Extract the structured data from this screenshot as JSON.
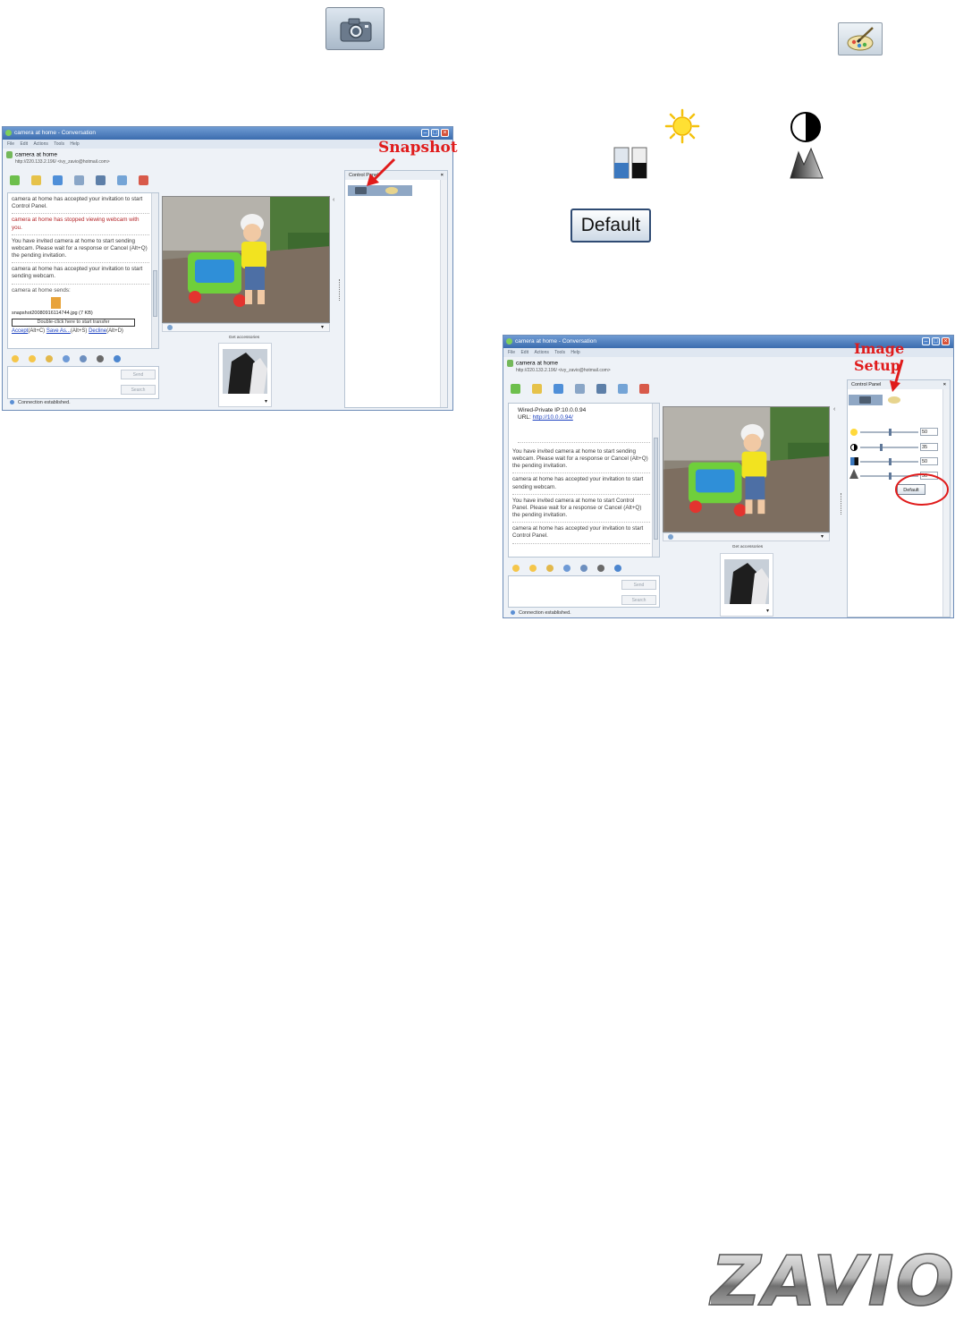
{
  "colors": {
    "accent_red": "#e01b1b",
    "title_blue": "#3b6cae",
    "logo_gray": "#8a8a8a"
  },
  "icons": {
    "snapshot_button": "camera-icon",
    "image_setup_button": "palette-brush-icon",
    "brightness": "sun-icon",
    "contrast": "half-circle-icon",
    "saturation": "color-bars-icon",
    "sharpness": "mountain-icon"
  },
  "default_button": {
    "label": "Default"
  },
  "window1": {
    "title": "camera at home - Conversation",
    "menu": [
      "File",
      "Edit",
      "Actions",
      "Tools",
      "Help"
    ],
    "contact_name": "camera at home",
    "contact_address": "http://220.133.2.196/ <ivy_zavio@hotmail.com>",
    "messages": [
      {
        "text": "camera at home has accepted your invitation to start Control Panel.",
        "style": "normal"
      },
      {
        "text": "camera at home has stopped viewing webcam with you.",
        "style": "red"
      },
      {
        "text": "You have invited camera at home to start sending webcam. Please wait for a response or Cancel (Alt+Q) the pending invitation.",
        "style": "normal"
      },
      {
        "text": "camera at home has accepted your invitation to start sending webcam.",
        "style": "normal"
      }
    ],
    "sends_line": "camera at home sends:",
    "file_name": "snapshot20080916114744.jpg (7 KB)",
    "transfer_hint": "Double-click here to start transfer",
    "accept": "Accept",
    "accept_key": "(Alt+C)",
    "save_as": "Save As...",
    "save_as_key": "(Alt+S)",
    "decline": "Decline",
    "decline_key": "(Alt+D)",
    "send_label": "Send",
    "search_label": "Search",
    "status": "Connection established.",
    "accessories_label": "Get accessories",
    "control_panel_label": "Control Panel",
    "annotation": "Snapshot"
  },
  "window2": {
    "title": "camera at home - Conversation",
    "menu": [
      "File",
      "Edit",
      "Actions",
      "Tools",
      "Help"
    ],
    "contact_name": "camera at home",
    "contact_address": "http://220.133.2.196/ <ivy_zavio@hotmail.com>",
    "wired_line": "Wired-Private IP:10.0.0.94",
    "url_label": "URL:",
    "url_link": "http://10.0.0.94/",
    "messages": [
      {
        "text": "You have invited camera at home to start sending webcam. Please wait for a response or Cancel (Alt+Q) the pending invitation.",
        "style": "normal"
      },
      {
        "text": "camera at home has accepted your invitation to start sending webcam.",
        "style": "normal"
      },
      {
        "text": "You have invited camera at home to start Control Panel. Please wait for a response or Cancel (Alt+Q) the pending invitation.",
        "style": "normal"
      },
      {
        "text": "camera at home has accepted your invitation to start Control Panel.",
        "style": "normal"
      }
    ],
    "send_label": "Send",
    "search_label": "Search",
    "status": "Connection established.",
    "accessories_label": "Get accessories",
    "control_panel_label": "Control Panel",
    "sliders": [
      {
        "name": "brightness",
        "value": "50",
        "level": 0.5
      },
      {
        "name": "contrast",
        "value": "35",
        "level": 0.35
      },
      {
        "name": "saturation",
        "value": "50",
        "level": 0.5
      },
      {
        "name": "sharpness",
        "value": "50",
        "level": 0.5
      }
    ],
    "default_label": "Default",
    "annotation": "Image Setup"
  },
  "logo_text": "ZAVIO"
}
